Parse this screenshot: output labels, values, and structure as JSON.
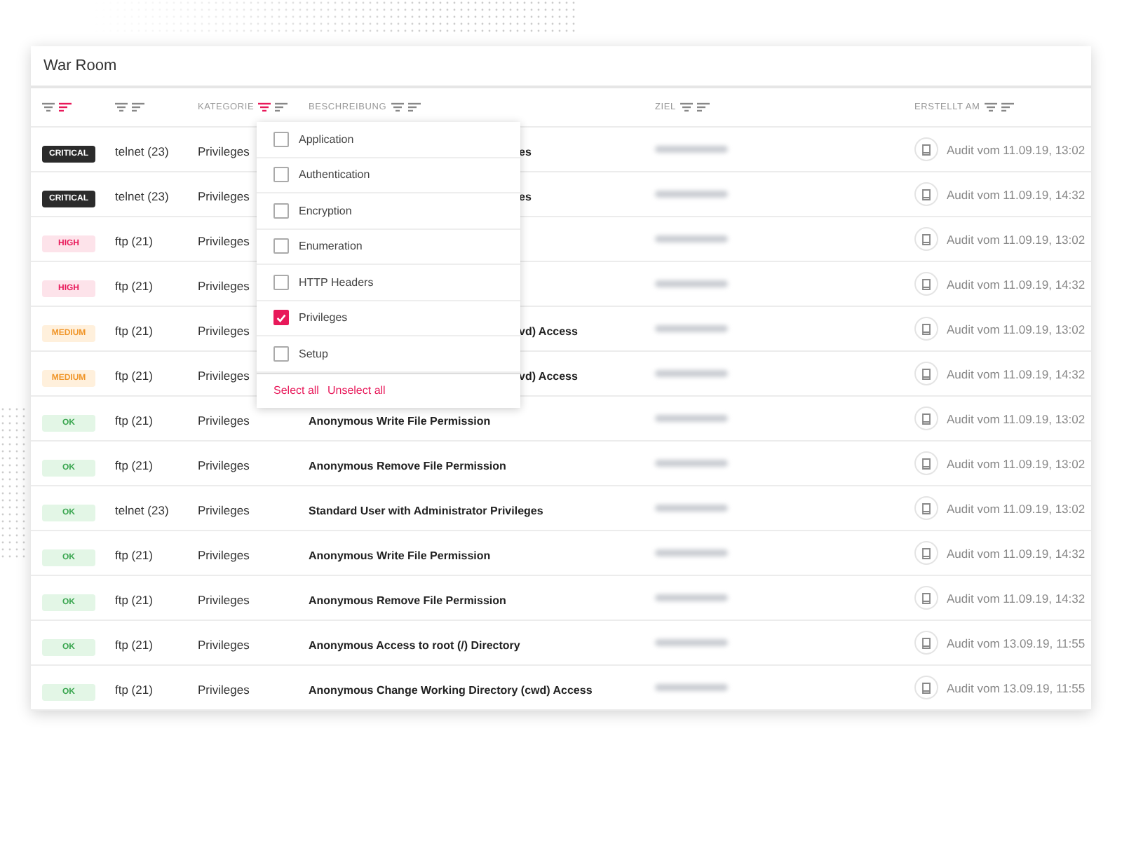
{
  "window": {
    "title": "War Room"
  },
  "columns": [
    {
      "filter_active": false,
      "sort_active": true
    },
    {
      "filter_active": false,
      "sort_active": false
    },
    {
      "label": "KATEGORIE",
      "filter_active": true,
      "sort_active": false
    },
    {
      "label": "BESCHREIBUNG",
      "filter_active": false,
      "sort_active": false
    },
    {
      "label": "ZIEL",
      "filter_active": false,
      "sort_active": false
    },
    {
      "label": "ERSTELLT AM",
      "filter_active": false,
      "sort_active": false
    }
  ],
  "rows": [
    {
      "severity": "CRITICAL",
      "kind": "critical",
      "service": "telnet (23)",
      "category": "Privileges",
      "description": "es",
      "partial": true,
      "created": "Audit vom 11.09.19, 13:02"
    },
    {
      "severity": "CRITICAL",
      "kind": "critical",
      "service": "telnet (23)",
      "category": "Privileges",
      "description": "es",
      "partial": true,
      "created": "Audit vom 11.09.19, 14:32"
    },
    {
      "severity": "HIGH",
      "kind": "high",
      "service": "ftp (21)",
      "category": "Privileges",
      "created": "Audit vom 11.09.19, 13:02"
    },
    {
      "severity": "HIGH",
      "kind": "high",
      "service": "ftp (21)",
      "category": "Privileges",
      "created": "Audit vom 11.09.19, 14:32"
    },
    {
      "severity": "MEDIUM",
      "kind": "medium",
      "service": "ftp (21)",
      "category": "Privileges",
      "description": "vd) Access",
      "partial": true,
      "created": "Audit vom 11.09.19, 13:02"
    },
    {
      "severity": "MEDIUM",
      "kind": "medium",
      "service": "ftp (21)",
      "category": "Privileges",
      "description": "vd) Access",
      "partial": true,
      "created": "Audit vom 11.09.19, 14:32"
    },
    {
      "severity": "OK",
      "kind": "ok",
      "service": "ftp (21)",
      "category": "Privileges",
      "description": "Anonymous Write File Permission",
      "partial": false,
      "created": "Audit vom 11.09.19, 13:02"
    },
    {
      "severity": "OK",
      "kind": "ok",
      "service": "ftp (21)",
      "category": "Privileges",
      "description": "Anonymous Remove File Permission",
      "partial": false,
      "created": "Audit vom 11.09.19, 13:02"
    },
    {
      "severity": "OK",
      "kind": "ok",
      "service": "telnet (23)",
      "category": "Privileges",
      "description": "Standard User with Administrator Privileges",
      "partial": false,
      "created": "Audit vom 11.09.19, 13:02"
    },
    {
      "severity": "OK",
      "kind": "ok",
      "service": "ftp (21)",
      "category": "Privileges",
      "description": "Anonymous Write File Permission",
      "partial": false,
      "created": "Audit vom 11.09.19, 14:32"
    },
    {
      "severity": "OK",
      "kind": "ok",
      "service": "ftp (21)",
      "category": "Privileges",
      "description": "Anonymous Remove File Permission",
      "partial": false,
      "created": "Audit vom 11.09.19, 14:32"
    },
    {
      "severity": "OK",
      "kind": "ok",
      "service": "ftp (21)",
      "category": "Privileges",
      "description": "Anonymous Access to root (/) Directory",
      "partial": false,
      "created": "Audit vom 13.09.19, 11:55"
    },
    {
      "severity": "OK",
      "kind": "ok",
      "service": "ftp (21)",
      "category": "Privileges",
      "description": "Anonymous Change Working Directory (cwd) Access",
      "partial": false,
      "created": "Audit vom 13.09.19, 11:55"
    }
  ],
  "filter_menu": {
    "options": [
      {
        "label": "Application",
        "checked": false
      },
      {
        "label": "Authentication",
        "checked": false
      },
      {
        "label": "Encryption",
        "checked": false
      },
      {
        "label": "Enumeration",
        "checked": false
      },
      {
        "label": "HTTP Headers",
        "checked": false
      },
      {
        "label": "Privileges",
        "checked": true
      },
      {
        "label": "Setup",
        "checked": false
      }
    ],
    "actions": [
      "Select all",
      "Unselect all"
    ]
  }
}
